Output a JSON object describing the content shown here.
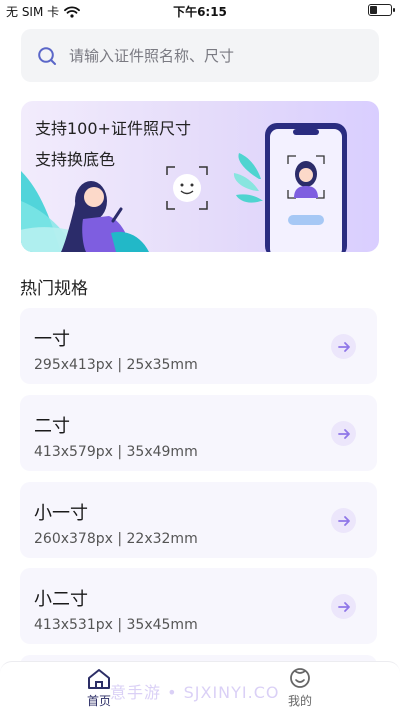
{
  "status_bar": {
    "carrier": "无 SIM 卡",
    "time": "下午6:15",
    "battery_level": 0.35
  },
  "search": {
    "placeholder": "请输入证件照名称、尺寸"
  },
  "banner": {
    "line1": "支持100+证件照尺寸",
    "line2": "支持换底色"
  },
  "section_title": "热门规格",
  "specs": [
    {
      "name": "一寸",
      "size": "295x413px | 25x35mm"
    },
    {
      "name": "二寸",
      "size": "413x579px | 35x49mm"
    },
    {
      "name": "小一寸",
      "size": "260x378px | 22x32mm"
    },
    {
      "name": "小二寸",
      "size": "413x531px | 35x45mm"
    }
  ],
  "tabbar": {
    "home_label": "首页",
    "mine_label": "我的",
    "active": "home"
  },
  "watermark": "意手游 • SJXINYI.CO",
  "colors": {
    "accent": "#8f76e8",
    "tab_active": "#2c2e66",
    "card_bg": "#f7f6fd",
    "arrow_bg": "#ece6fb"
  },
  "icons": {
    "search": "search-icon",
    "arrow": "arrow-right-icon",
    "home": "home-icon",
    "mine": "user-icon",
    "wifi": "wifi-icon",
    "battery": "battery-icon"
  }
}
